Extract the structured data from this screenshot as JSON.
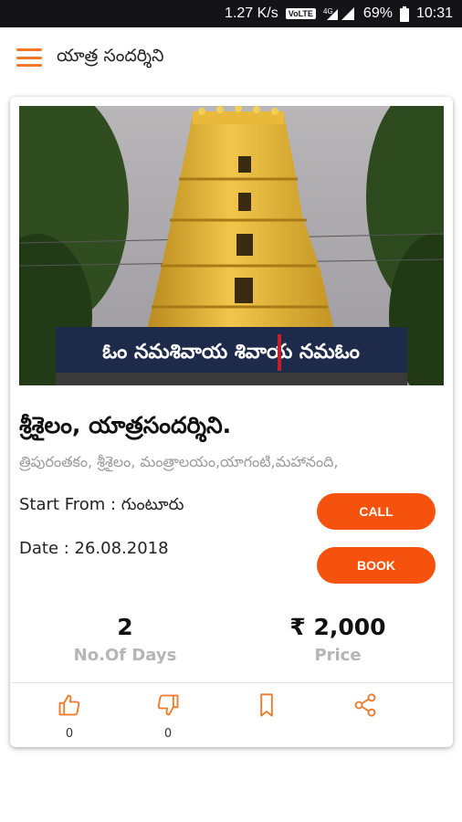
{
  "status_bar": {
    "speed": "1.27 K/s",
    "volte": "VoLTE",
    "network": "4G",
    "battery": "69%",
    "time": "10:31"
  },
  "app_bar": {
    "title": "యాత్ర సందర్శిని"
  },
  "card": {
    "image_alt": "Srisailam temple gopuram",
    "image_banner": "ఓం నమశివాయ శివాయ నమఓం",
    "title": "శ్రీశైలం, యాత్రసందర్శిని.",
    "places": "త్రిపురంతకం, శ్రీశైలం, మంత్రాలయం,యాగంటి,మహానంది,",
    "start_from": "Start From : గుంటూరు",
    "date": "Date : 26.08.2018",
    "call_label": "CALL",
    "book_label": "BOOK",
    "days_value": "2",
    "days_label": "No.Of Days",
    "price_value": "₹ 2,000",
    "price_label": "Price",
    "likes": "0",
    "dislikes": "0"
  },
  "colors": {
    "accent": "#f5520e",
    "icon": "#f07a2a"
  },
  "icons": [
    "menu-icon",
    "thumbs-up-icon",
    "thumbs-down-icon",
    "bookmark-icon",
    "share-icon"
  ]
}
